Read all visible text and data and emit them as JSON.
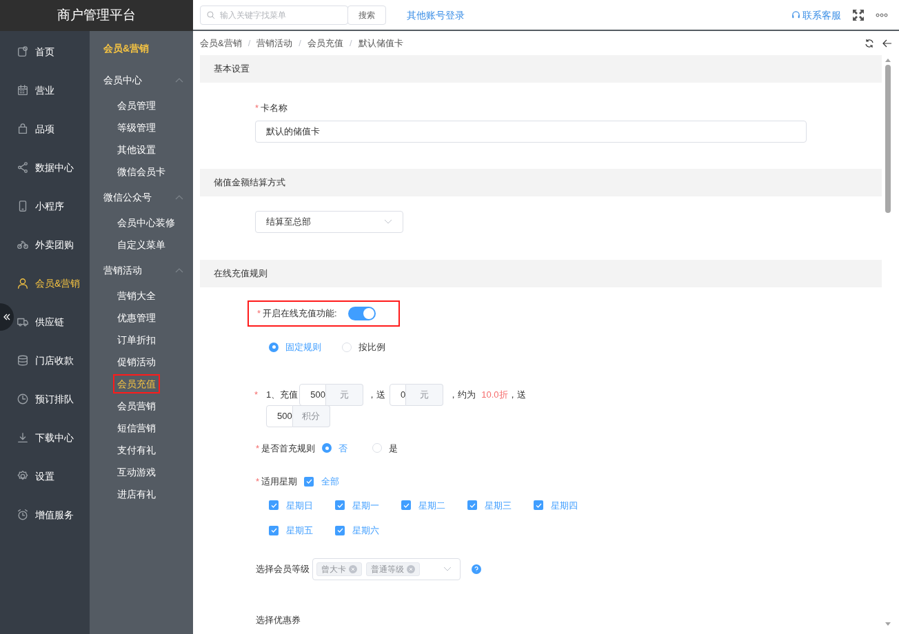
{
  "brand": "商户管理平台",
  "header": {
    "search_placeholder": "输入关键字找菜单",
    "search_button": "搜索",
    "other_login": "其他账号登录",
    "support": "联系客服"
  },
  "nav": [
    {
      "label": "首页",
      "selected": false
    },
    {
      "label": "营业",
      "selected": false
    },
    {
      "label": "品项",
      "selected": false
    },
    {
      "label": "数据中心",
      "selected": false
    },
    {
      "label": "小程序",
      "selected": false
    },
    {
      "label": "外卖团购",
      "selected": false
    },
    {
      "label": "会员&营销",
      "selected": true
    },
    {
      "label": "供应链",
      "selected": false
    },
    {
      "label": "门店收款",
      "selected": false
    },
    {
      "label": "预订排队",
      "selected": false
    },
    {
      "label": "下载中心",
      "selected": false
    },
    {
      "label": "设置",
      "selected": false
    },
    {
      "label": "增值服务",
      "selected": false
    }
  ],
  "subnav": {
    "title": "会员&营销",
    "groups": [
      {
        "label": "会员中心",
        "expanded": true,
        "items": [
          {
            "label": "会员管理",
            "selected": false,
            "highlighted": false
          },
          {
            "label": "等级管理",
            "selected": false,
            "highlighted": false
          },
          {
            "label": "其他设置",
            "selected": false,
            "highlighted": false
          },
          {
            "label": "微信会员卡",
            "selected": false,
            "highlighted": false
          }
        ]
      },
      {
        "label": "微信公众号",
        "expanded": true,
        "items": [
          {
            "label": "会员中心装修",
            "selected": false,
            "highlighted": false
          },
          {
            "label": "自定义菜单",
            "selected": false,
            "highlighted": false
          }
        ]
      },
      {
        "label": "营销活动",
        "expanded": true,
        "items": [
          {
            "label": "营销大全",
            "selected": false,
            "highlighted": false
          },
          {
            "label": "优惠管理",
            "selected": false,
            "highlighted": false
          },
          {
            "label": "订单折扣",
            "selected": false,
            "highlighted": false
          },
          {
            "label": "促销活动",
            "selected": false,
            "highlighted": false
          },
          {
            "label": "会员充值",
            "selected": true,
            "highlighted": true
          },
          {
            "label": "会员营销",
            "selected": false,
            "highlighted": false
          },
          {
            "label": "短信营销",
            "selected": false,
            "highlighted": false
          },
          {
            "label": "支付有礼",
            "selected": false,
            "highlighted": false
          },
          {
            "label": "互动游戏",
            "selected": false,
            "highlighted": false
          },
          {
            "label": "进店有礼",
            "selected": false,
            "highlighted": false
          }
        ]
      }
    ]
  },
  "breadcrumb": [
    "会员&营销",
    "营销活动",
    "会员充值",
    "默认储值卡"
  ],
  "breadcrumb_separators": [
    "/",
    "/",
    "/"
  ],
  "required_marks": [
    "*",
    "*",
    "*",
    "*",
    "*"
  ],
  "basic": {
    "title": "基本设置",
    "card_name_label": "卡名称",
    "card_name_value": "默认的储值卡"
  },
  "settlement": {
    "title": "储值金额结算方式",
    "value": "结算至总部"
  },
  "online": {
    "title": "在线充值规则",
    "switch_label": "开启在线充值功能:",
    "switch_on": true,
    "switch_highlighted": true,
    "modes": [
      {
        "label": "固定规则",
        "selected": true
      },
      {
        "label": "按比例",
        "selected": false
      }
    ],
    "rule": {
      "prefix": "1、充值",
      "recharge": "500",
      "recharge_unit": "元",
      "gift_sep": "，送",
      "gift": "0",
      "gift_unit": "元",
      "approx": "，约为",
      "discount": "10.0折",
      "points_sep": "，送",
      "points": "500",
      "points_unit": "积分"
    },
    "first_label": "是否首充规则",
    "first_options": [
      {
        "label": "否",
        "selected": true
      },
      {
        "label": "是",
        "selected": false
      }
    ],
    "weekday_label": "适用星期",
    "all": {
      "label": "全部",
      "checked": true
    },
    "weekdays": [
      {
        "label": "星期日",
        "checked": true
      },
      {
        "label": "星期一",
        "checked": true
      },
      {
        "label": "星期二",
        "checked": true
      },
      {
        "label": "星期三",
        "checked": true
      },
      {
        "label": "星期四",
        "checked": true
      },
      {
        "label": "星期五",
        "checked": true
      },
      {
        "label": "星期六",
        "checked": true
      }
    ],
    "level_label": "选择会员等级",
    "level_tags": [
      "曾大卡",
      "普通等级"
    ],
    "coupon_label": "选择优惠券"
  }
}
